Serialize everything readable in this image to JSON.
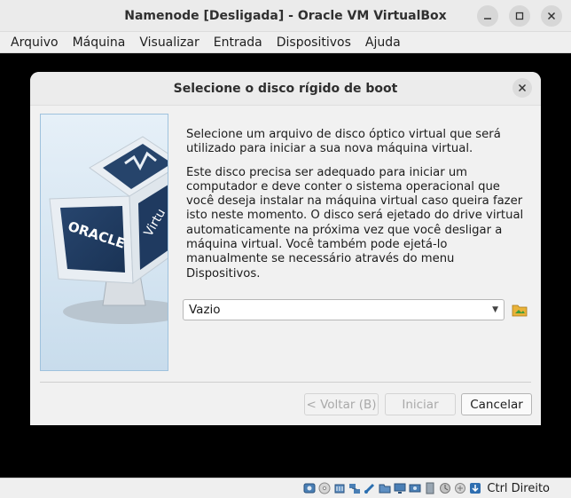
{
  "window": {
    "title": "Namenode [Desligada] - Oracle VM VirtualBox",
    "minimize_icon": "minimize-icon",
    "maximize_icon": "maximize-icon",
    "close_icon": "close-icon"
  },
  "menubar": {
    "items": [
      "Arquivo",
      "Máquina",
      "Visualizar",
      "Entrada",
      "Dispositivos",
      "Ajuda"
    ]
  },
  "dialog": {
    "title": "Selecione o disco rígido de boot",
    "illustration_text": "ORACLE",
    "illustration_text2": "Virtu",
    "paragraph1": "Selecione um arquivo de disco óptico virtual que será utilizado para iniciar a sua nova máquina virtual.",
    "paragraph2": "Este disco precisa ser adequado para iniciar um computador e deve conter o sistema operacional que você deseja instalar na máquina virtual caso queira fazer isto neste momento. O disco será ejetado do drive virtual automaticamente na próxima vez que você desligar a máquina virtual. Você também pode ejetá-lo manualmente se necessário através do menu Dispositivos.",
    "combo_value": "Vazio",
    "buttons": {
      "back": "< Voltar (B)",
      "start": "Iniciar",
      "cancel": "Cancelar"
    }
  },
  "statusbar": {
    "host_key": "Ctrl Direito",
    "icons": [
      "hard-disk-icon",
      "optical-disk-icon",
      "audio-icon",
      "network-icon",
      "usb-icon",
      "shared-folders-icon",
      "display-icon",
      "video-capture-icon",
      "virtualization-icon",
      "cpu-icon",
      "mouse-integration-icon",
      "host-key-icon"
    ]
  },
  "colors": {
    "vm_background": "#000000",
    "dialog_background": "#f1f1f1",
    "illustration_background": "#d7e7f3"
  }
}
